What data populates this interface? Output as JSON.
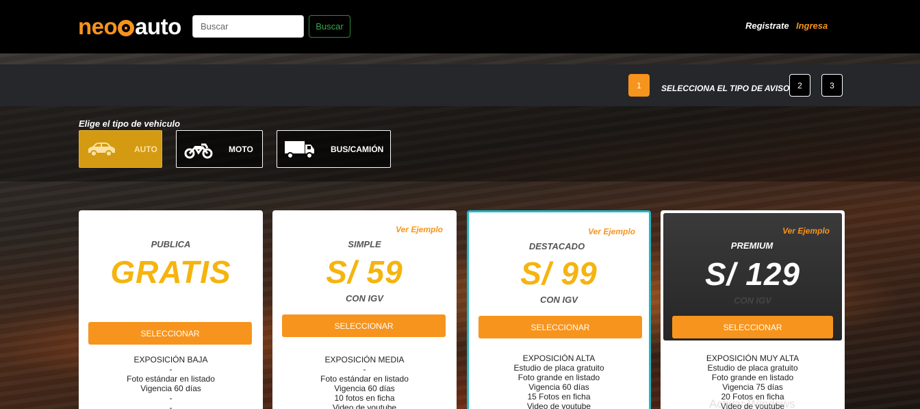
{
  "header": {
    "logo_neo": "neo",
    "logo_auto": "auto",
    "search_placeholder": "Buscar",
    "search_button": "Buscar",
    "register": "Registrate",
    "login": "Ingresa"
  },
  "steps": {
    "current": "1",
    "label": "SELECCIONA EL TIPO DE AVISO",
    "next": [
      "2",
      "3"
    ]
  },
  "vehicle": {
    "title": "Elige el tipo de vehiculo",
    "options": [
      {
        "label": "AUTO",
        "icon": "car-icon",
        "selected": true
      },
      {
        "label": "MOTO",
        "icon": "motorcycle-icon",
        "selected": false
      },
      {
        "label": "BUS/CAMIÓN",
        "icon": "truck-icon",
        "selected": false
      }
    ]
  },
  "plans": [
    {
      "name": "PUBLICA",
      "price": "GRATIS",
      "igv": "",
      "example": "",
      "button": "SELECCIONAR",
      "features": [
        "EXPOSICIÓN BAJA",
        "-",
        "Foto estándar en listado",
        "Vigencia 60 días",
        "-",
        "-"
      ]
    },
    {
      "name": "SIMPLE",
      "price": "S/ 59",
      "igv": "CON IGV",
      "example": "Ver Ejemplo",
      "button": "SELECCIONAR",
      "features": [
        "EXPOSICIÓN MEDIA",
        "-",
        "Foto estándar en listado",
        "Vigencia 60 días",
        "10 fotos en ficha",
        "Video de youtube"
      ]
    },
    {
      "name": "DESTACADO",
      "price": "S/ 99",
      "igv": "CON IGV",
      "example": "Ver Ejemplo",
      "button": "SELECCIONAR",
      "features": [
        "EXPOSICIÓN ALTA",
        "Estudio de placa gratuito",
        "Foto grande en listado",
        "Vigencia 60 días",
        "15 Fotos en ficha",
        "Video de youtube"
      ]
    },
    {
      "name": "PREMIUM",
      "price": "S/ 129",
      "igv": "CON IGV",
      "example": "Ver Ejemplo",
      "button": "SELECCIONAR",
      "features": [
        "EXPOSICIÓN MUY ALTA",
        "Estudio de placa gratuito",
        "Foto grande en listado",
        "Vigencia 75 días",
        "20 Fotos en ficha",
        "Video de youtube"
      ]
    }
  ],
  "watermark": "Activar Windows",
  "colors": {
    "accent": "#f7941d",
    "price": "#f5b40e",
    "highlight_border": "#22b8c9",
    "search_button": "#3aa64a"
  }
}
